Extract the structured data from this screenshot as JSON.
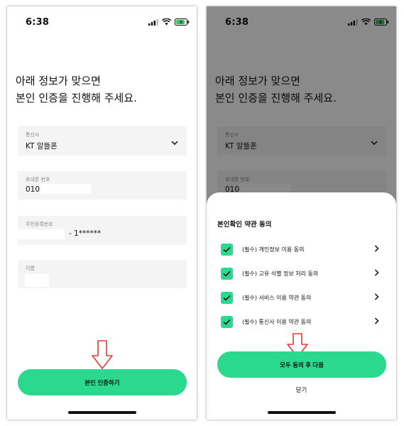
{
  "status_bar": {
    "time": "6:38"
  },
  "headline": {
    "line1": "아래 정보가 맞으면",
    "line2": "본인 인증을 진행해 주세요."
  },
  "form": {
    "carrier": {
      "label": "통신사",
      "value": "KT 알뜰폰"
    },
    "phone": {
      "label": "휴대폰 번호",
      "value": "010"
    },
    "resident_id": {
      "label": "주민등록번호",
      "value": "- 1******"
    },
    "name": {
      "label": "이름",
      "value": ""
    }
  },
  "verify_button": {
    "label": "본인 인증하기"
  },
  "consent_sheet": {
    "title": "본인확인 약관 동의",
    "items": [
      {
        "label": "(필수) 개인정보 이용 동의",
        "checked": true
      },
      {
        "label": "(필수) 고유 식별 정보 처리 동의",
        "checked": true
      },
      {
        "label": "(필수) 서비스 이용 약관 동의",
        "checked": true
      },
      {
        "label": "(필수) 통신사 이용 약관 동의",
        "checked": true
      }
    ],
    "agree_button": "모두 동의 후 다음",
    "close_button": "닫기"
  },
  "colors": {
    "accent": "#2ad98e",
    "field_bg": "#f4f4f4",
    "arrow": "#e53935",
    "dim_overlay": "rgba(0,0,0,0.46)"
  },
  "icons": [
    "signal-icon",
    "wifi-icon",
    "battery-icon",
    "chevron-down-icon",
    "chevron-right-icon",
    "check-icon",
    "down-arrow-annotation"
  ]
}
